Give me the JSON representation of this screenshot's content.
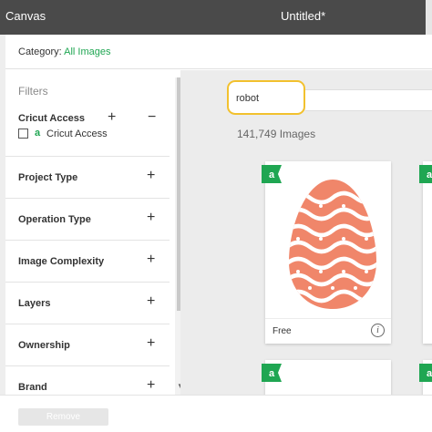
{
  "window": {
    "app_title": "Canvas",
    "document_title": "Untitled*"
  },
  "category": {
    "label": "Category: ",
    "value": "All Images"
  },
  "filters": {
    "title": "Filters",
    "cricut_access": {
      "title": "Cricut Access",
      "plus": "+",
      "minus": "−",
      "logo": "a",
      "checkbox_label": "Cricut Access",
      "checked": false
    },
    "sections": [
      {
        "label": "Project Type",
        "toggle": "+"
      },
      {
        "label": "Operation Type",
        "toggle": "+"
      },
      {
        "label": "Image Complexity",
        "toggle": "+"
      },
      {
        "label": "Layers",
        "toggle": "+"
      },
      {
        "label": "Ownership",
        "toggle": "+"
      },
      {
        "label": "Brand",
        "toggle": "+"
      }
    ],
    "scroll_arrow": "▼"
  },
  "search": {
    "value": "robot"
  },
  "results": {
    "count_text": "141,749 Images",
    "cards": [
      {
        "price": "Free",
        "info": "i",
        "image_icon": "easter-egg-image",
        "badge_icon": "cricut-access-badge-icon"
      }
    ]
  },
  "footer": {
    "remove_label": "Remove"
  },
  "colors": {
    "accent_green": "#1fa652",
    "highlight_yellow": "#f2c12e",
    "egg_coral": "#f0866a",
    "titlebar": "#4a4a4a"
  }
}
